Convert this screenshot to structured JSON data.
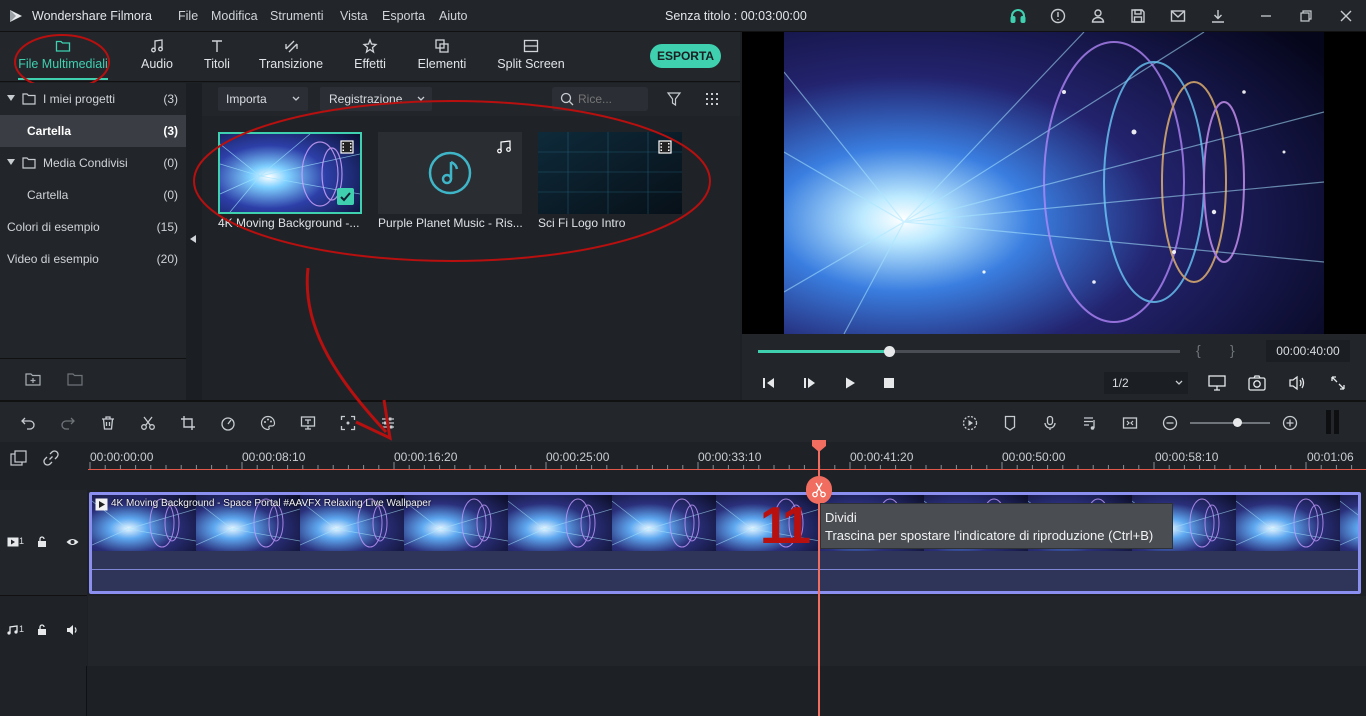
{
  "app": {
    "name": "Wondershare Filmora",
    "doc_title": "Senza titolo : 00:03:00:00"
  },
  "menu": [
    "File",
    "Modifica",
    "Strumenti",
    "Vista",
    "Esporta",
    "Aiuto"
  ],
  "tabs": [
    {
      "label": "File Multimediali",
      "icon": "folder-icon"
    },
    {
      "label": "Audio",
      "icon": "music-note-icon"
    },
    {
      "label": "Titoli",
      "icon": "text-icon"
    },
    {
      "label": "Transizione",
      "icon": "transition-icon"
    },
    {
      "label": "Effetti",
      "icon": "effects-icon"
    },
    {
      "label": "Elementi",
      "icon": "elements-icon"
    },
    {
      "label": "Split Screen",
      "icon": "split-screen-icon"
    }
  ],
  "export_label": "ESPORTA",
  "tree": [
    {
      "label": "I miei progetti",
      "count": "(3)"
    },
    {
      "label": "Cartella",
      "count": "(3)"
    },
    {
      "label": "Media Condivisi",
      "count": "(0)"
    },
    {
      "label": "Cartella",
      "count": "(0)"
    },
    {
      "label": "Colori di esempio",
      "count": "(15)"
    },
    {
      "label": "Video di esempio",
      "count": "(20)"
    }
  ],
  "media_bar": {
    "import": "Importa",
    "record": "Registrazione",
    "search_placeholder": "Rice..."
  },
  "media": [
    {
      "label": "4K Moving Background -...",
      "type": "video"
    },
    {
      "label": "Purple Planet Music - Ris...",
      "type": "audio"
    },
    {
      "label": "Sci Fi Logo Intro",
      "type": "video"
    }
  ],
  "preview": {
    "timecode": "00:00:40:00",
    "quality": "1/2",
    "progress": 0.31,
    "mark_in": "{",
    "mark_out": "}"
  },
  "ruler": [
    "00:00:00:00",
    "00:00:08:10",
    "00:00:16:20",
    "00:00:25:00",
    "00:00:33:10",
    "00:00:41:20",
    "00:00:50:00",
    "00:00:58:10",
    "00:01:06"
  ],
  "clip_title": "4K Moving Background - Space Portal #AAVFX Relaxing Live Wallpaper",
  "tooltip": {
    "title": "Dividi",
    "text": "Trascina per spostare l'indicatore di riproduzione (Ctrl+B)"
  },
  "annotation_number": "11",
  "track_labels": {
    "video": "1",
    "audio": "1"
  },
  "colors": {
    "accent": "#3fd0b0",
    "playhead": "#f06d5f",
    "annotation": "#b80f0f",
    "clip_border": "#8a8ff0"
  }
}
